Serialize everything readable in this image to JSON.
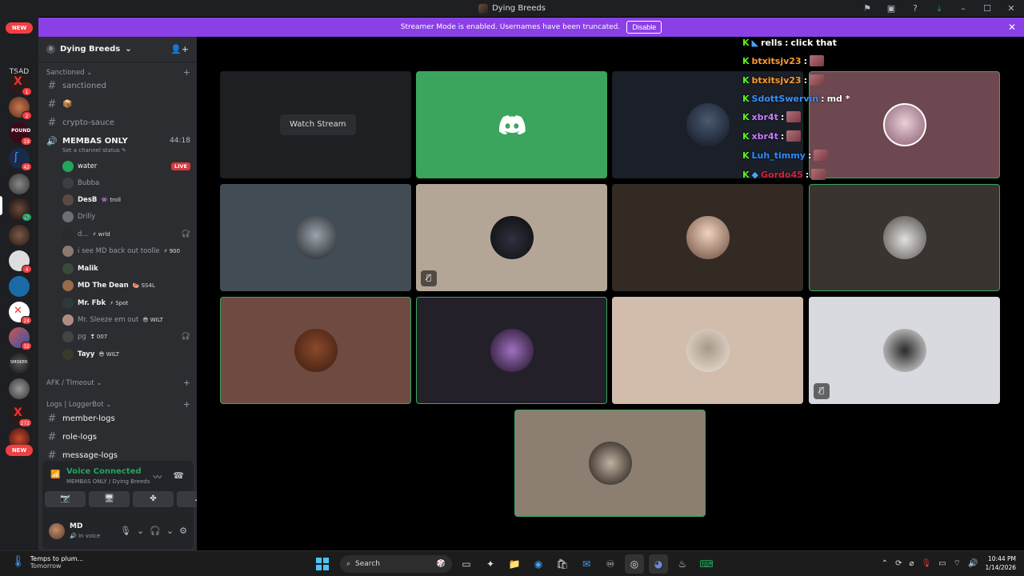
{
  "window": {
    "title": "Dying Breeds"
  },
  "banner": {
    "text": "Streamer Mode is enabled. Usernames have been truncated.",
    "disable_label": "Disable"
  },
  "guild_rail": {
    "new_top": "NEW",
    "tsad_label": "TSAD",
    "new_bottom": "NEW",
    "badges": [
      "1",
      "2",
      "19",
      "42",
      "4",
      "3",
      "24",
      "32",
      "272"
    ]
  },
  "server": {
    "name": "Dying Breeds",
    "categories": {
      "sanctioned": "Sanctioned",
      "afk": "AFK / TImeout",
      "logs": "Logs | LoggerBot"
    },
    "channels": {
      "sanctioned": "sanctioned",
      "box": "📦",
      "crypto": "crypto-sauce",
      "member_logs": "member-logs",
      "role_logs": "role-logs",
      "message_logs": "message-logs"
    },
    "voice_channel": {
      "name": "MEMBAS ONLY",
      "time": "44:18",
      "status_hint": "Set a channel status"
    },
    "voice_users": [
      {
        "name": "water",
        "tag": "",
        "live": "LIVE",
        "bright": true,
        "color": "#23a55a"
      },
      {
        "name": "Bubba",
        "tag": "",
        "bright": false,
        "color": "#3a3f46"
      },
      {
        "name": "DesB",
        "tag": "troll",
        "bright": true,
        "color": "#5a4a44"
      },
      {
        "name": "Drilly",
        "tag": "",
        "bright": false,
        "color": "#6a6f78"
      },
      {
        "name": "d...",
        "tag": "wrld",
        "bright": false,
        "color": "#2a2a2a",
        "deaf": true
      },
      {
        "name": "i see MD back out toolle",
        "tag": "900",
        "bright": false,
        "color": "#8a7a70"
      },
      {
        "name": "Malik",
        "tag": "",
        "bright": true,
        "color": "#3a4a3a"
      },
      {
        "name": "MD The Dean",
        "tag": "SS4L",
        "bright": true,
        "color": "#9a6a4a"
      },
      {
        "name": "Mr. Fbk",
        "tag": "Spot",
        "bright": true,
        "color": "#2e3a3a"
      },
      {
        "name": "Mr. Sleeze em out",
        "tag": "WILT",
        "bright": false,
        "color": "#b08c84"
      },
      {
        "name": "pg",
        "tag": "007",
        "bright": false,
        "color": "#444",
        "deaf": true
      },
      {
        "name": "Tayy",
        "tag": "WILT",
        "bright": true,
        "color": "#3a3a2a"
      }
    ]
  },
  "voice_panel": {
    "title": "Voice Connected",
    "subtitle": "MEMBAS ONLY / Dying Breeds"
  },
  "user_panel": {
    "name": "MD",
    "status": "In voice"
  },
  "stage": {
    "watch_stream": "Watch Stream"
  },
  "chat_overlay": [
    {
      "user": "rells",
      "msg": "click that",
      "color": "#ffffff",
      "emote": false
    },
    {
      "user": "btxitsjv23",
      "msg": "",
      "color": "#ff9a2e",
      "emote": true
    },
    {
      "user": "btxitsjv23",
      "msg": "",
      "color": "#ff9a2e",
      "emote": true
    },
    {
      "user": "SdottSwervin",
      "msg": "md *",
      "color": "#3a8fff",
      "emote": false
    },
    {
      "user": "xbr4t",
      "msg": "",
      "color": "#c77dff",
      "emote": true
    },
    {
      "user": "xbr4t",
      "msg": "",
      "color": "#c77dff",
      "emote": true
    },
    {
      "user": "Luh_timmy",
      "msg": "",
      "color": "#2e8bff",
      "emote": true
    },
    {
      "user": "Gordo45",
      "msg": "",
      "color": "#d0243f",
      "emote": true
    }
  ],
  "taskbar": {
    "weather_line1": "Temps to plum...",
    "weather_line2": "Tomorrow",
    "search_placeholder": "Search",
    "time": "10:44 PM",
    "date": "1/14/2026"
  }
}
